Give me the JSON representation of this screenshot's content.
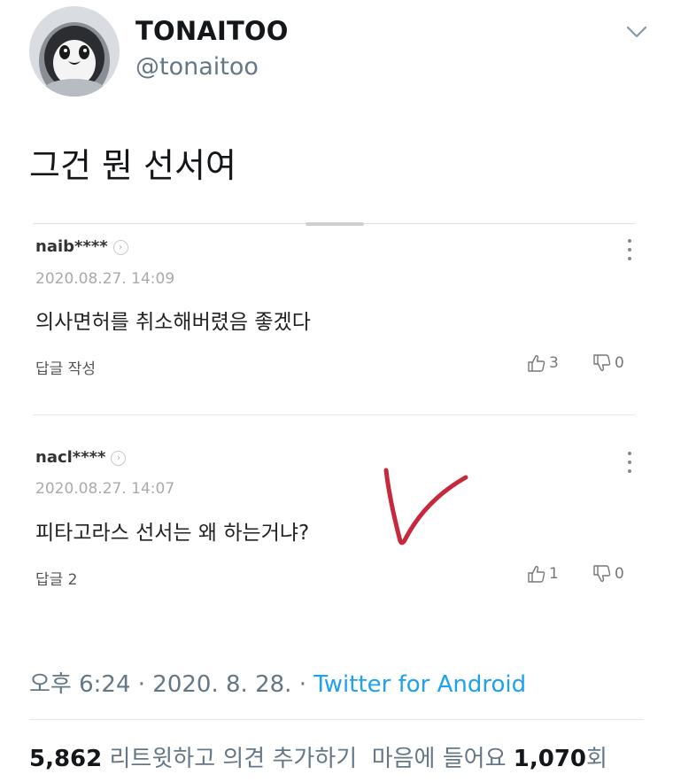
{
  "author": {
    "display_name": "TONAITOO",
    "handle": "@tonaitoo",
    "avatar_icon": "penguin-chick-avatar"
  },
  "tweet": {
    "text": "그건 뭔 선서여"
  },
  "embedded_image": {
    "comments": [
      {
        "user": "naib****",
        "date": "2020.08.27. 14:09",
        "body": "의사면허를 취소해버렸음 좋겠다",
        "reply_label": "답글 작성",
        "likes": "3",
        "dislikes": "0"
      },
      {
        "user": "nacl****",
        "date": "2020.08.27. 14:07",
        "body": "피타고라스 선서는 왜 하는거냐?",
        "reply_label": "답글 2",
        "likes": "1",
        "dislikes": "0"
      }
    ],
    "annotation_icon": "red-checkmark-icon",
    "annotation_color": "#c8283c"
  },
  "meta": {
    "time": "오후 6:24",
    "separator": "·",
    "date": "2020. 8. 28.",
    "source": "Twitter for Android"
  },
  "stats": {
    "retweets_count": "5,862",
    "retweets_label": "리트윗",
    "quote_label": "하고 의견 추가하기",
    "likes_label": "마음에 들어요",
    "likes_count": "1,070",
    "likes_suffix": "회"
  },
  "colors": {
    "text_primary": "#14171a",
    "text_secondary": "#657786",
    "link": "#1da1f2"
  }
}
